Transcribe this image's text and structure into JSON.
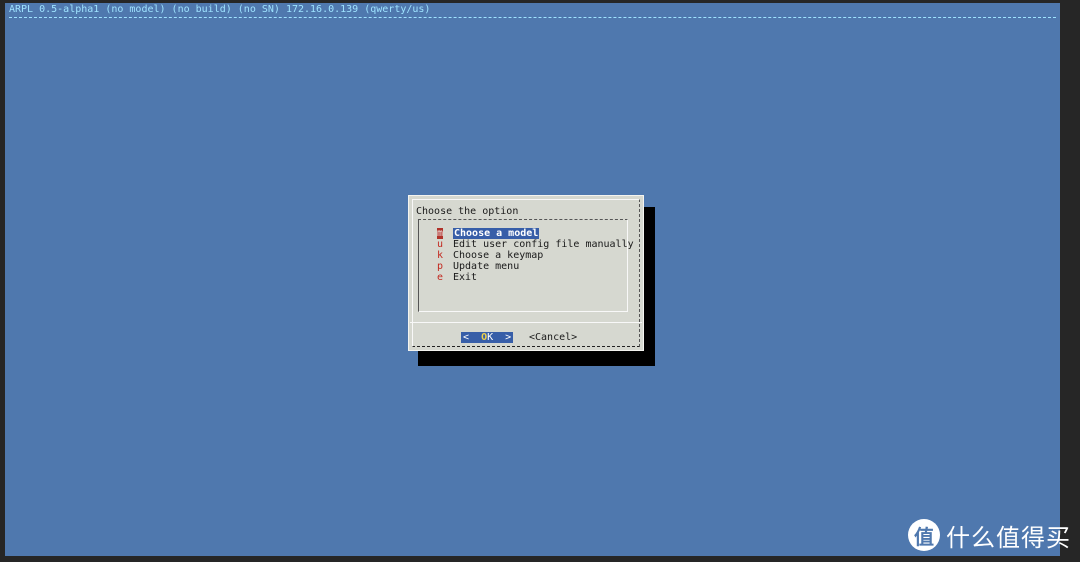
{
  "backtitle": "ARPL 0.5-alpha1 (no model) (no build) (no SN) 172.16.0.139 (qwerty/us)",
  "dialog": {
    "prompt": "Choose the option",
    "menu": [
      {
        "tag": "m",
        "label": "Choose a model",
        "selected": true
      },
      {
        "tag": "u",
        "label": "Edit user config file manually",
        "selected": false
      },
      {
        "tag": "k",
        "label": "Choose a keymap",
        "selected": false
      },
      {
        "tag": "p",
        "label": "Update menu",
        "selected": false
      },
      {
        "tag": "e",
        "label": "Exit",
        "selected": false
      }
    ],
    "buttons": {
      "ok": {
        "left": "<  ",
        "hot": "O",
        "rest": "K  >"
      },
      "cancel": "<Cancel>"
    }
  },
  "watermark": {
    "logo_glyph": "值",
    "text": "什么值得买"
  },
  "colors": {
    "terminal_bg": "#4f78ae",
    "dialog_bg": "#d6d8d0",
    "highlight": "#375ea8",
    "tag_red": "#c2281f",
    "backtitle": "#9fe3ff"
  }
}
